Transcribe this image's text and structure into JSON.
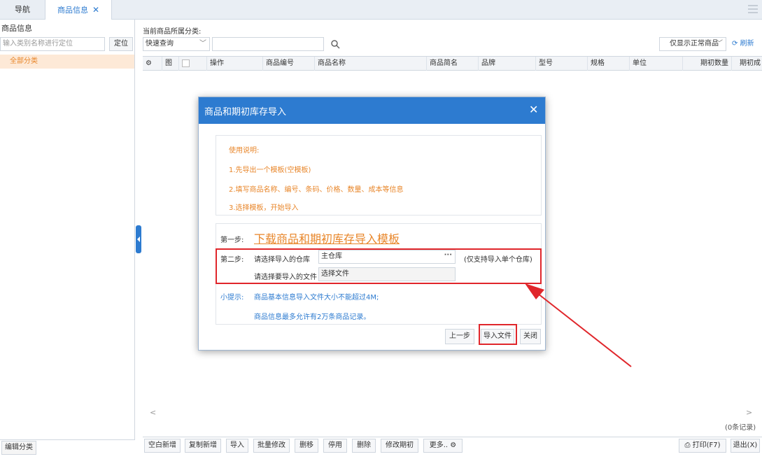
{
  "tabs": {
    "nav": "导航",
    "goods": "商品信息",
    "close": "✕"
  },
  "left": {
    "title": "商品信息",
    "search_placeholder": "输入类别名称进行定位",
    "locate_button": "定位",
    "all_category": "全部分类",
    "edit_category_button": "编辑分类"
  },
  "main": {
    "category_label": "当前商品所属分类:",
    "quick_query": "快速查询",
    "filter": "仅显示正常商品",
    "refresh": "刷新",
    "record_count": "(0条记录)"
  },
  "grid": {
    "columns": [
      "图",
      "操作",
      "商品编号",
      "商品名称",
      "商品简名",
      "品牌",
      "型号",
      "规格",
      "单位",
      "期初数量",
      "期初成"
    ]
  },
  "toolbar": {
    "buttons": [
      "空白新增",
      "复制新增",
      "导入",
      "批量修改",
      "删移",
      "停用",
      "删除",
      "修改期初",
      "更多..",
      "打印(F7)",
      "退出(X)"
    ]
  },
  "dialog": {
    "title": "商品和期初库存导入",
    "close": "✕",
    "instructions": {
      "heading": "使用说明:",
      "line1": "1.先导出一个模板(空模板)",
      "line2": "2.填写商品名称、编号、条码、价格、数量、成本等信息",
      "line3": "3.选择模板，开始导入"
    },
    "step1_label": "第一步:",
    "download_link": "下载商品和期初库存导入模板",
    "step2_label": "第二步:",
    "warehouse_label": "请选择导入的仓库",
    "warehouse_value": "主仓库",
    "warehouse_note": "(仅支持导入单个仓库)",
    "file_label": "请选择要导入的文件",
    "file_value": "选择文件",
    "tip_label": "小提示:",
    "tip1": "商品基本信息导入文件大小不能超过4M;",
    "tip2": "商品信息最多允许有2万条商品记录。",
    "prev_button": "上一步",
    "import_button": "导入文件",
    "close_button": "关闭"
  },
  "colors": {
    "accent": "#2d7bd0",
    "orange": "#e8862a",
    "annotation_red": "#e0262b"
  }
}
